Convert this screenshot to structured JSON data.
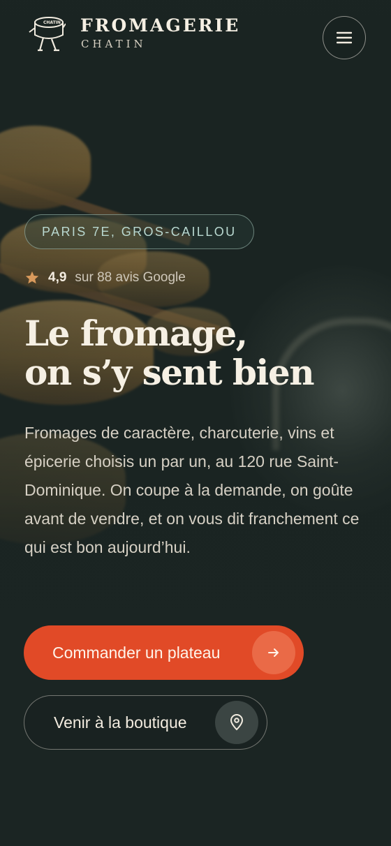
{
  "header": {
    "brand_name": "FROMAGERIE",
    "brand_sub": "CHATIN",
    "logo_text": "CHATIN",
    "menu_icon": "hamburger-menu-icon"
  },
  "hero": {
    "badge": "PARIS 7E, GROS-CAILLOU",
    "rating": {
      "icon": "star-icon",
      "score": "4,9",
      "reviews": "sur 88 avis Google"
    },
    "title_line1": "Le fromage,",
    "title_line2": "on s’y sent bien",
    "description": "Fromages de caractère, charcuterie, vins et épicerie choisis un par un, au 120 rue Saint-Dominique. On coupe à la demande, on goûte avant de vendre, et on vous dit franchement ce qui est bon aujourd’hui.",
    "primary_cta": {
      "label": "Commander un plateau",
      "icon": "arrow-right-icon"
    },
    "secondary_cta": {
      "label": "Venir à la boutique",
      "icon": "map-pin-icon"
    }
  },
  "colors": {
    "background": "#1b2523",
    "accent": "#e14a27",
    "badge_text": "#b9d8d0",
    "star": "#d99a5c"
  }
}
